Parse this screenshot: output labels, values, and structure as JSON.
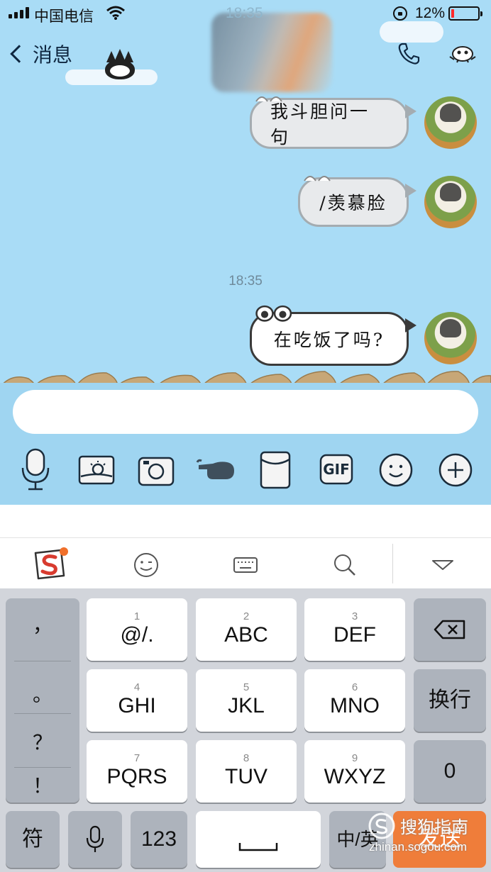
{
  "status_bar": {
    "carrier": "中国电信",
    "time": "18:35",
    "battery_percent": "12%",
    "battery_level": 0.12,
    "battery_color": "#ff2a2a"
  },
  "header": {
    "back_label": "消息",
    "icons": [
      "chevron-left-icon",
      "phone-icon",
      "profile-icon"
    ]
  },
  "messages": [
    {
      "text": "我斗胆问一句",
      "from": "me"
    },
    {
      "text": "/羡慕脸",
      "from": "me"
    },
    {
      "text": "在吃饭了吗?",
      "from": "me"
    }
  ],
  "time_divider": "18:35",
  "input": {
    "value": "",
    "placeholder": ""
  },
  "toolbar": {
    "items": [
      "microphone-icon",
      "photo-icon",
      "camera-icon",
      "poke-icon",
      "red-packet-icon",
      "gif-icon",
      "emoji-icon",
      "plus-icon"
    ],
    "gif_label": "GIF"
  },
  "keyboard": {
    "topbar": [
      "sogou-logo",
      "emoji-icon",
      "keyboard-icon",
      "search-icon",
      "collapse-icon"
    ],
    "punctuation": [
      "，",
      "。",
      "？",
      "！"
    ],
    "keys": [
      {
        "num": "1",
        "label": "@/."
      },
      {
        "num": "2",
        "label": "ABC"
      },
      {
        "num": "3",
        "label": "DEF"
      },
      {
        "num": "4",
        "label": "GHI"
      },
      {
        "num": "5",
        "label": "JKL"
      },
      {
        "num": "6",
        "label": "MNO"
      },
      {
        "num": "7",
        "label": "PQRS"
      },
      {
        "num": "8",
        "label": "TUV"
      },
      {
        "num": "9",
        "label": "WXYZ"
      }
    ],
    "newline": "换行",
    "zero": "0",
    "symbols": "符",
    "num_mode": "123",
    "lang": "中/英",
    "send": "发送"
  },
  "watermark": {
    "name": "搜狗指南",
    "url": "zhinan.sogou.com"
  },
  "colors": {
    "chat_bg": "#a9dcf6",
    "send": "#ef7d3a",
    "keyboard_bg": "#d2d5db"
  }
}
